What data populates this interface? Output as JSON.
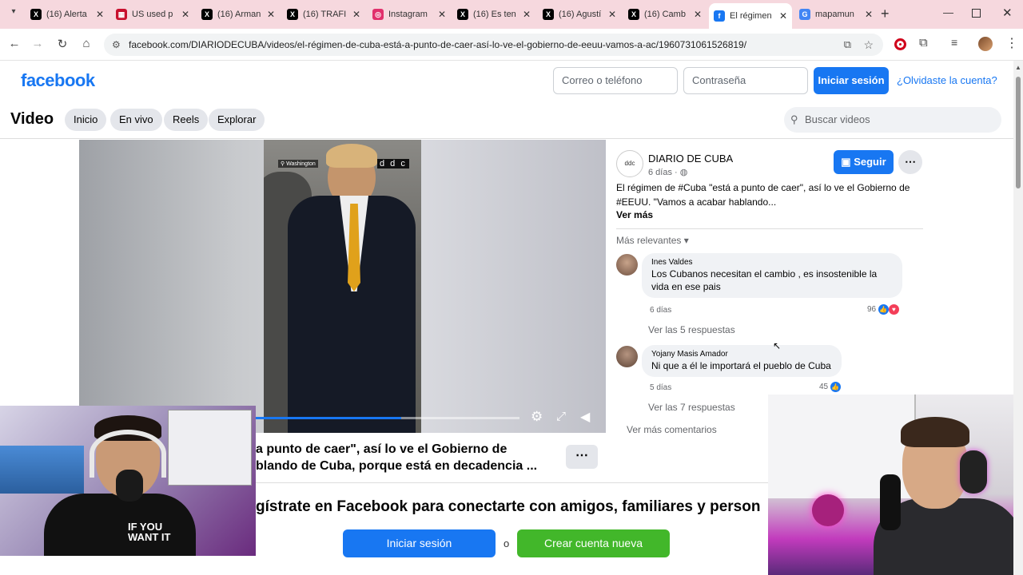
{
  "browser": {
    "tabs": [
      {
        "title": "(16) Alerta",
        "fav": "X",
        "color": "#000000"
      },
      {
        "title": "US used p",
        "fav": "▦",
        "color": "#c8102e"
      },
      {
        "title": "(16) Arman",
        "fav": "X",
        "color": "#000000"
      },
      {
        "title": "(16) TRAFI",
        "fav": "X",
        "color": "#000000"
      },
      {
        "title": "Instagram",
        "fav": "◎",
        "color": "#e1306c"
      },
      {
        "title": "(16) Es ten",
        "fav": "X",
        "color": "#000000"
      },
      {
        "title": "(16) Agustí",
        "fav": "X",
        "color": "#000000"
      },
      {
        "title": "(16) Camb",
        "fav": "X",
        "color": "#000000"
      },
      {
        "title": "El régimen",
        "fav": "f",
        "color": "#1877f2"
      },
      {
        "title": "mapamun",
        "fav": "G",
        "color": "#4285f4"
      }
    ],
    "url": "facebook.com/DIARIODECUBA/videos/el-régimen-de-cuba-está-a-punto-de-caer-así-lo-ve-el-gobierno-de-eeuu-vamos-a-ac/1960731061526819/"
  },
  "header": {
    "logo": "facebook",
    "email_placeholder": "Correo o teléfono",
    "password_placeholder": "Contraseña",
    "login_label": "Iniciar sesión",
    "forgot_label": "¿Olvidaste la cuenta?"
  },
  "subnav": {
    "title": "Video",
    "pills": [
      "Inicio",
      "En vivo",
      "Reels",
      "Explorar"
    ],
    "search_placeholder": "Buscar videos"
  },
  "video": {
    "location_tag": "Washington",
    "watermark": "d d c",
    "progress_fraction": 0.55
  },
  "post": {
    "page_name": "DIARIO DE CUBA",
    "avatar_text": "ddc",
    "time": "6 días ·",
    "follow_label": "Seguir",
    "text_line1": "El régimen de #Cuba \"está a punto de caer\", así lo ve el Gobierno de",
    "text_line2": "#EEUU. \"Vamos a acabar hablando...",
    "see_more": "Ver más",
    "sort_label": "Más relevantes"
  },
  "comments": [
    {
      "author": "Ines Valdes",
      "text1": "Los Cubanos necesitan el cambio , es insostenible la",
      "text2": "vida en ese pais",
      "time": "6 días",
      "count": "96",
      "replies": "Ver las 5 respuestas"
    },
    {
      "author": "Yojany Masis Amador",
      "text1": "Ni que a él le importará el pueblo de Cuba",
      "text2": "",
      "time": "5 días",
      "count": "45",
      "replies": "Ver las 7 respuestas"
    }
  ],
  "more_comments": "Ver más comentarios",
  "caption": {
    "line1": "a punto de caer\", así lo ve el Gobierno de",
    "line2": "blando de Cuba, porque está en decadencia ..."
  },
  "banner": {
    "text": "gístrate en Facebook para conectarte con amigos, familiares y person",
    "login_label": "Iniciar sesión",
    "or_label": "o",
    "create_label": "Crear cuenta nueva"
  },
  "webcam_left_shirt": "IF YOU WANT IT"
}
